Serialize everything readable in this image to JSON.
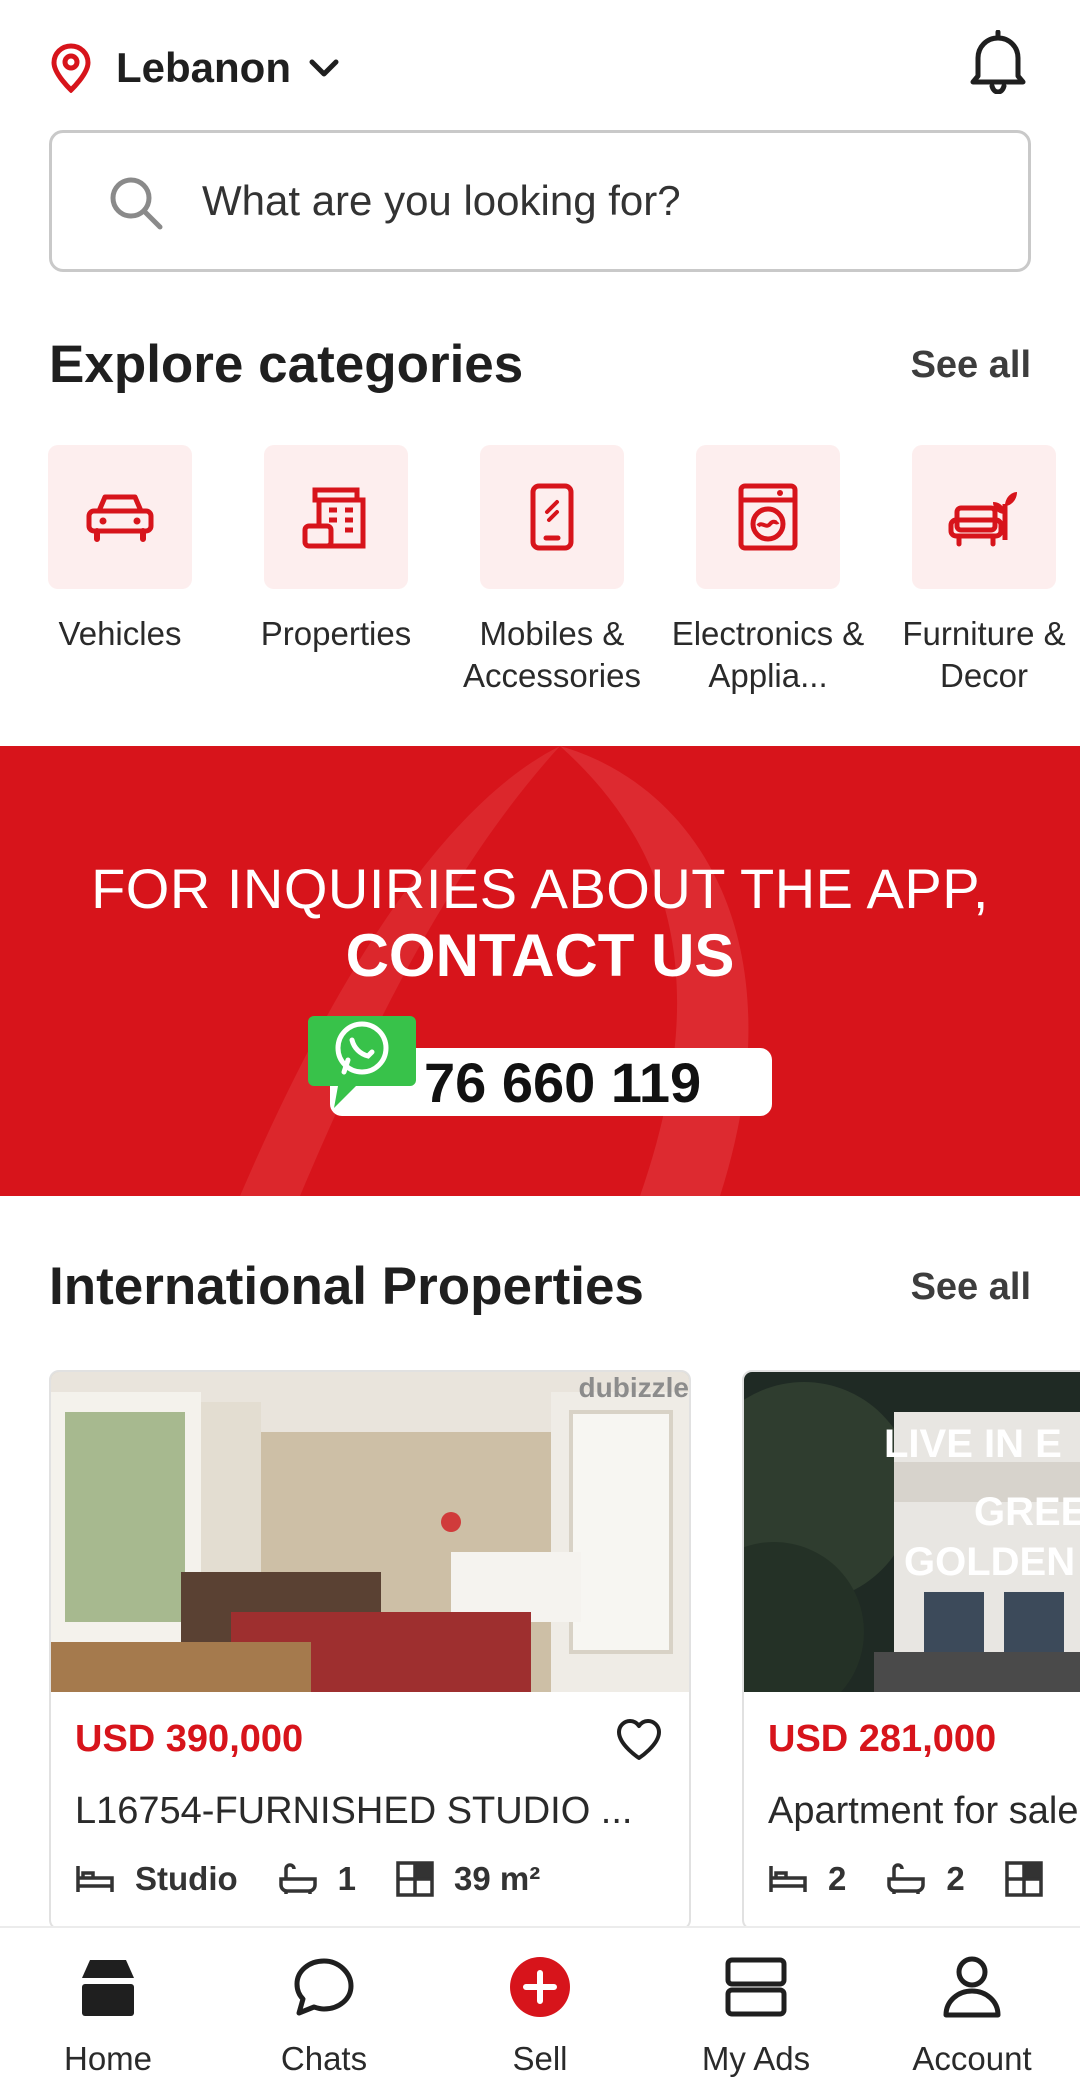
{
  "header": {
    "location": "Lebanon",
    "location_icon": "map-pin-icon",
    "notifications_icon": "bell-icon"
  },
  "search": {
    "placeholder": "What are you looking for?"
  },
  "categories": {
    "title": "Explore categories",
    "see_all": "See all",
    "items": [
      {
        "label": "Vehicles",
        "icon": "car-icon"
      },
      {
        "label": "Properties",
        "icon": "building-icon"
      },
      {
        "label": "Mobiles & Accessories",
        "icon": "mobile-phone-icon"
      },
      {
        "label": "Electronics & Applia...",
        "icon": "washing-machine-icon"
      },
      {
        "label": "Furniture & Decor",
        "icon": "armchair-plant-icon"
      }
    ]
  },
  "banner": {
    "line1": "FOR INQUIRIES ABOUT THE APP,",
    "line2": "CONTACT US",
    "phone": "76 660 119",
    "icon": "whatsapp-icon"
  },
  "international": {
    "title": "International Properties",
    "see_all": "See all",
    "listings": [
      {
        "price": "USD 390,000",
        "title": "L16754-FURNISHED STUDIO ...",
        "bedrooms": "Studio",
        "bathrooms": "1",
        "area": "39 m²",
        "image_text": "dubizzle"
      },
      {
        "price": "USD 281,000",
        "title": "Apartment for sale",
        "bedrooms": "2",
        "bathrooms": "2",
        "area": "",
        "image_text_1": "LIVE IN E",
        "image_text_2": "GREE",
        "image_text_3": "GOLDEN"
      }
    ]
  },
  "nav": {
    "items": [
      {
        "label": "Home",
        "icon": "home-icon"
      },
      {
        "label": "Chats",
        "icon": "chat-bubble-icon"
      },
      {
        "label": "Sell",
        "icon": "plus-circle-icon"
      },
      {
        "label": "My Ads",
        "icon": "my-ads-icon"
      },
      {
        "label": "Account",
        "icon": "person-icon"
      }
    ]
  },
  "colors": {
    "accent": "#d7141b",
    "tile_bg": "#fdeeee"
  }
}
